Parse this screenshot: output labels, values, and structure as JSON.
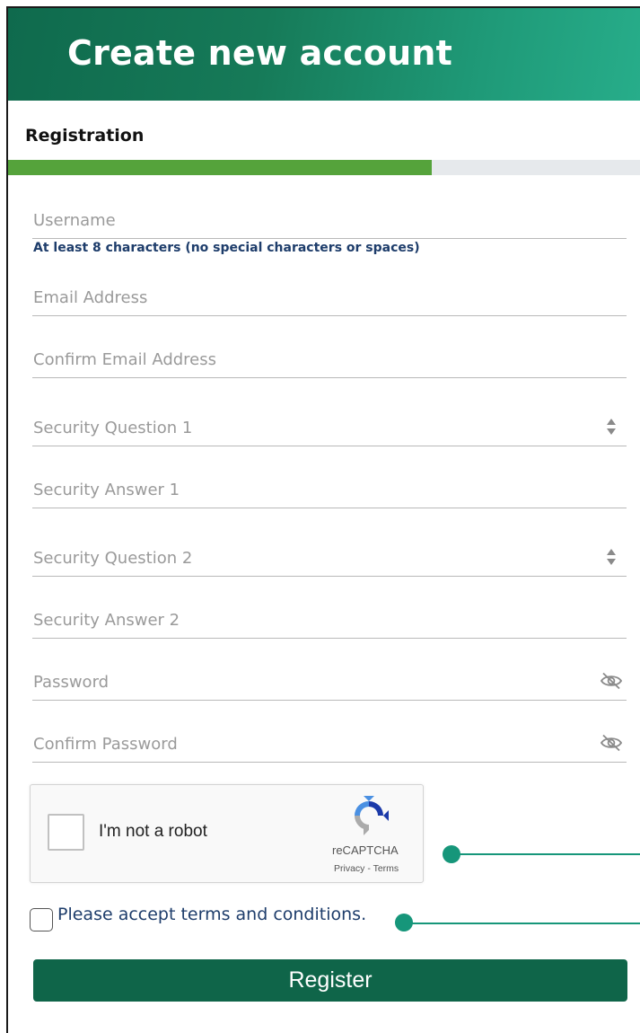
{
  "header": {
    "title": "Create new account"
  },
  "section": {
    "label": "Registration"
  },
  "progress": {
    "fraction": 0.67
  },
  "fields": {
    "username": {
      "label": "Username",
      "hint": "At least 8 characters (no special characters or spaces)"
    },
    "email": {
      "label": "Email Address"
    },
    "confirm_email": {
      "label": "Confirm Email Address"
    },
    "security_question_1": {
      "label": "Security Question 1",
      "icon": "select-arrows-icon"
    },
    "security_answer_1": {
      "label": "Security Answer 1"
    },
    "security_question_2": {
      "label": "Security Question 2",
      "icon": "select-arrows-icon"
    },
    "security_answer_2": {
      "label": "Security Answer 2"
    },
    "password": {
      "label": "Password",
      "icon": "eye-slash-icon"
    },
    "confirm_password": {
      "label": "Confirm Password",
      "icon": "eye-slash-icon"
    }
  },
  "captcha": {
    "label": "I'm not a robot",
    "brand": "reCAPTCHA",
    "links": "Privacy - Terms"
  },
  "terms": {
    "label": "Please accept terms and conditions."
  },
  "register": {
    "label": "Register"
  },
  "colors": {
    "header": "#167a58",
    "progress": "#55a33b",
    "button": "#0f6549",
    "callout": "#16967a",
    "link_text": "#1e3d6b"
  }
}
